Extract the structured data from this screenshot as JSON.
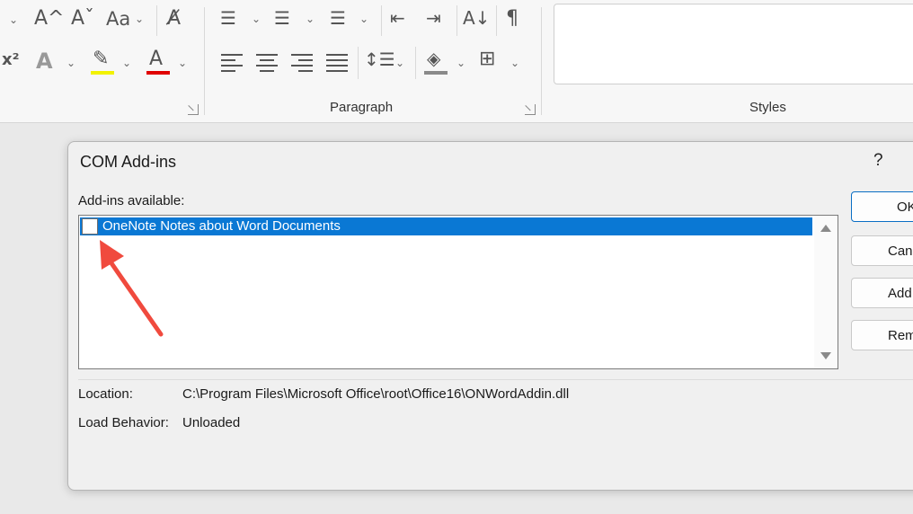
{
  "ribbon": {
    "font_icons": {
      "grow_font": "A^",
      "shrink_font": "Aˇ",
      "change_case": "Aa",
      "superscript": "x²",
      "text_effects": "A",
      "font_color": "A"
    },
    "paragraph_icons": {
      "sort": "A↓",
      "show_marks": "¶"
    },
    "group_labels": {
      "paragraph": "Paragraph",
      "styles": "Styles"
    }
  },
  "dialog": {
    "title": "COM Add-ins",
    "help": "?",
    "list_label": "Add-ins available:",
    "items": [
      {
        "label": "OneNote Notes about Word Documents",
        "checked": false,
        "selected": true
      }
    ],
    "location_label": "Location:",
    "location_value": "C:\\Program Files\\Microsoft Office\\root\\Office16\\ONWordAddin.dll",
    "load_behavior_label": "Load Behavior:",
    "load_behavior_value": "Unloaded",
    "buttons": {
      "ok": "OK",
      "cancel": "Cancel",
      "add": "Add...",
      "remove": "Remove"
    }
  },
  "colors": {
    "selection": "#0a78d4",
    "annotation_arrow": "#f04a3e",
    "highlight_bar": "#f2f200",
    "font_color_bar": "#e00000"
  }
}
